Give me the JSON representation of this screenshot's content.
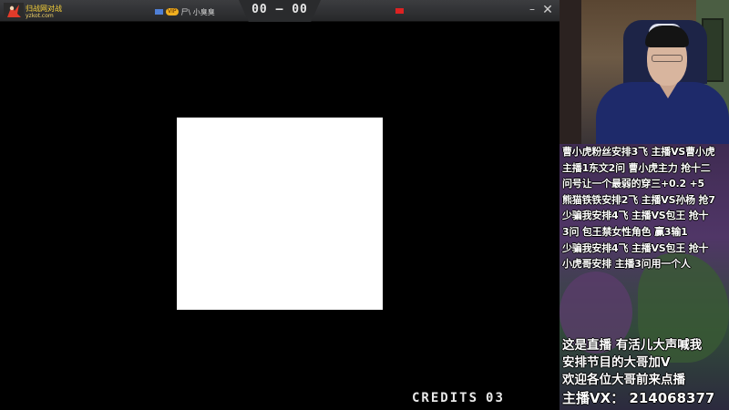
{
  "window": {
    "brand_name": "归战网对战",
    "brand_url": "yzkot.com",
    "score": "00 – 00",
    "left_player_badge": "VIP",
    "left_player_name": "尸\\ 小臭臭",
    "minimize_glyph": "–",
    "close_glyph": "✕"
  },
  "game": {
    "credits_label": "CREDITS",
    "credits_value": "03"
  },
  "stream": {
    "queue_lines": [
      "曹小虎粉丝安排3飞 主播VS曹小虎",
      "主播1东文2问 曹小虎主力 抢十二",
      "问号让一个最弱的穿三+0.2 +5",
      "熊猫铁铁安排2飞 主播VS孙杨 抢7",
      "少骗我安排4飞 主播VS包王 抢十",
      "3问 包王禁女性角色 赢3输1",
      "少骗我安排4飞 主播VS包王 抢十",
      "小虎哥安排 主播3问用一个人"
    ],
    "promo_lines": [
      "这是直播 有活儿大声喊我",
      "安排节目的大哥加V",
      "欢迎各位大哥前来点播"
    ],
    "contact": "主播VX：  214068377"
  },
  "colors": {
    "titlebar": "#323336",
    "flash": "#ffffff",
    "player_flag_left": "#4f7fd6",
    "player_flag_right": "#dd2222"
  }
}
